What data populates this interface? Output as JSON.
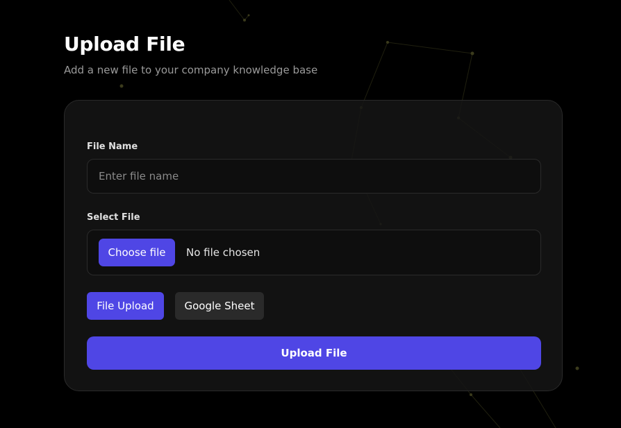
{
  "header": {
    "title": "Upload File",
    "subtitle": "Add a new file to your company knowledge base"
  },
  "form": {
    "file_name_label": "File Name",
    "file_name_placeholder": "Enter file name",
    "file_name_value": "",
    "select_file_label": "Select File",
    "choose_file_button": "Choose file",
    "file_status": "No file chosen",
    "source_tabs": [
      {
        "label": "File Upload",
        "active": true
      },
      {
        "label": "Google Sheet",
        "active": false
      }
    ],
    "submit_label": "Upload File"
  },
  "theme": {
    "accent": "#4f46e5",
    "background": "#000000",
    "card": "#161616",
    "network_dot": "#3b3b1c"
  }
}
